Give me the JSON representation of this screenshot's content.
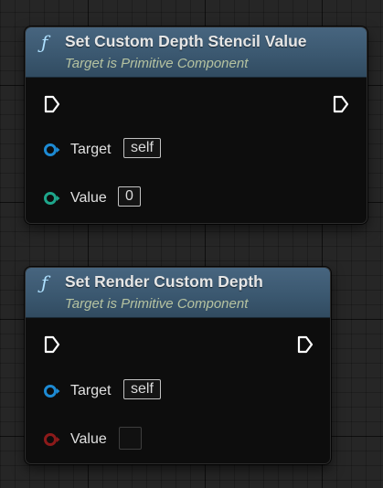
{
  "nodes": [
    {
      "title": "Set Custom Depth Stencil Value",
      "subtitle": "Target is Primitive Component",
      "target_label": "Target",
      "target_value": "self",
      "value_label": "Value",
      "value_value": "0"
    },
    {
      "title": "Set Render Custom Depth",
      "subtitle": "Target is Primitive Component",
      "target_label": "Target",
      "target_value": "self",
      "value_label": "Value",
      "value_checked": false
    }
  ],
  "icons": {
    "function": "ƒ",
    "exec_pin": "exec-arrow-icon",
    "object_pin": "blue-object-pin-icon",
    "integer_pin": "green-integer-pin-icon",
    "boolean_pin": "red-boolean-pin-icon"
  },
  "colors": {
    "header": "#3d5a72",
    "object_pin": "#1d8ad3",
    "integer_pin": "#1ea68b",
    "boolean_pin": "#8c1a1a",
    "node_body": "#0d0d0d"
  }
}
